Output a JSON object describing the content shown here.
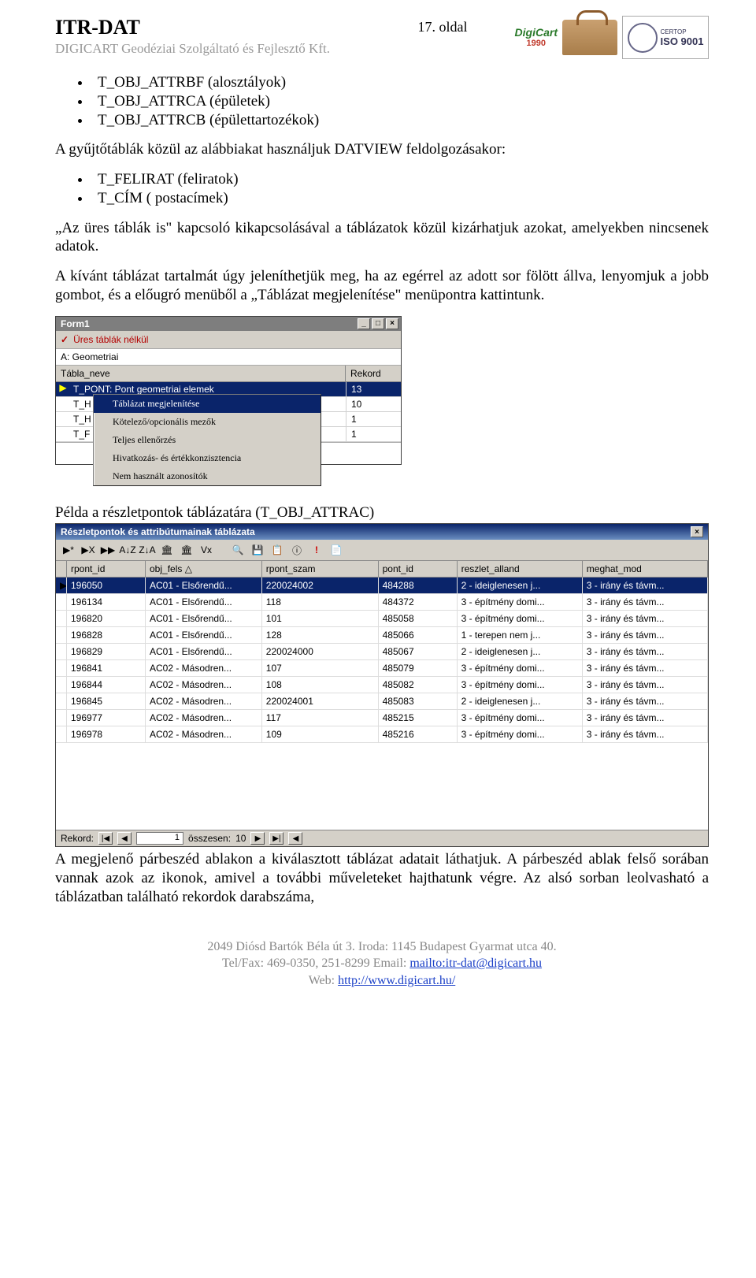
{
  "header": {
    "title": "ITR-DAT",
    "subtitle": "DIGICART Geodéziai Szolgáltató és Fejlesztő Kft.",
    "page_label": "17. oldal",
    "digicart": "DigiCart",
    "digicart_year": "1990",
    "iso": "ISO 9001",
    "certop": "CERTOP"
  },
  "bullets_a": [
    "T_OBJ_ATTRBF (alosztályok)",
    "T_OBJ_ATTRCA (épületek)",
    "T_OBJ_ATTRCB (épülettartozékok)"
  ],
  "para1": "A gyűjtőtáblák közül az alábbiakat használjuk DATVIEW feldolgozásakor:",
  "bullets_b": [
    "T_FELIRAT (feliratok)",
    "T_CÍM ( postacímek)"
  ],
  "para2": "„Az üres táblák is\" kapcsoló kikapcsolásával a táblázatok közül kizárhatjuk azokat, amelyekben nincsenek adatok.",
  "para3": "A kívánt táblázat tartalmát úgy jeleníthetjük meg, ha az egérrel az adott sor fölött állva, lenyomjuk a jobb gombot, és a előugró menüből a „Táblázat megjelenítése\" menüpontra kattintunk.",
  "form1": {
    "title": "Form1",
    "checkbox_label": "Üres táblák nélkül",
    "field_A": "A: Geometriai",
    "col_name": "Tábla_neve",
    "col_rec": "Rekord",
    "rows": [
      {
        "name": "T_PONT: Pont geometriai elemek",
        "rec": "13",
        "sel": true
      },
      {
        "name": "T_H",
        "rec": "10"
      },
      {
        "name": "T_H",
        "rec": "1"
      },
      {
        "name": "T_F",
        "rec": "1"
      }
    ],
    "context_menu": [
      "Táblázat megjelenítése",
      "Kötelező/opcionális mezők",
      "Teljes ellenőrzés",
      "Hivatkozás- és értékkonzisztencia",
      "Nem használt azonosítók"
    ]
  },
  "para_example": "Példa a részletpontok táblázatára (T_OBJ_ATTRAC)",
  "bigwin": {
    "title": "Részletpontok és attribútumainak táblázata",
    "toolbar_icons": [
      "▶*",
      "▶X",
      "▶▶",
      "A↓Z",
      "Z↓A",
      "🏛",
      "🏛",
      "Vx",
      "",
      "🔍",
      "💾",
      "📋",
      "ⓘ",
      "!",
      "📄"
    ],
    "cols": [
      "rpont_id",
      "obj_fels △",
      "rpont_szam",
      "pont_id",
      "reszlet_alland",
      "meghat_mod"
    ],
    "rows": [
      {
        "sel": true,
        "c": [
          "196050",
          "AC01 - Elsőrendű...",
          "220024002",
          "484288",
          "2 - ideiglenesen j...",
          "3 - irány és távm..."
        ]
      },
      {
        "c": [
          "196134",
          "AC01 - Elsőrendű...",
          "118",
          "484372",
          "3 - építmény domi...",
          "3 - irány és távm..."
        ]
      },
      {
        "c": [
          "196820",
          "AC01 - Elsőrendű...",
          "101",
          "485058",
          "3 - építmény domi...",
          "3 - irány és távm..."
        ]
      },
      {
        "c": [
          "196828",
          "AC01 - Elsőrendű...",
          "128",
          "485066",
          "1 - terepen nem j...",
          "3 - irány és távm..."
        ]
      },
      {
        "c": [
          "196829",
          "AC01 - Elsőrendű...",
          "220024000",
          "485067",
          "2 - ideiglenesen j...",
          "3 - irány és távm..."
        ]
      },
      {
        "c": [
          "196841",
          "AC02 - Másodren...",
          "107",
          "485079",
          "3 - építmény domi...",
          "3 - irány és távm..."
        ]
      },
      {
        "c": [
          "196844",
          "AC02 - Másodren...",
          "108",
          "485082",
          "3 - építmény domi...",
          "3 - irány és távm..."
        ]
      },
      {
        "c": [
          "196845",
          "AC02 - Másodren...",
          "220024001",
          "485083",
          "2 - ideiglenesen j...",
          "3 - irány és távm..."
        ]
      },
      {
        "c": [
          "196977",
          "AC02 - Másodren...",
          "117",
          "485215",
          "3 - építmény domi...",
          "3 - irány és távm..."
        ]
      },
      {
        "c": [
          "196978",
          "AC02 - Másodren...",
          "109",
          "485216",
          "3 - építmény domi...",
          "3 - irány és távm..."
        ]
      }
    ],
    "status": {
      "rekord_lbl": "Rekord:",
      "current": "1",
      "total_lbl": "összesen:",
      "total": "10"
    }
  },
  "para4": "A megjelenő párbeszéd ablakon a kiválasztott táblázat adatait láthatjuk. A párbeszéd ablak felső sorában vannak azok az ikonok, amivel a további műveleteket hajthatunk végre. Az alsó sorban leolvasható a táblázatban található rekordok darabszáma,",
  "footer": {
    "line1": "2049 Diósd Bartók Béla út 3. Iroda: 1145 Budapest Gyarmat utca 40.",
    "line2a": "Tel/Fax: 469-0350, 251-8299 Email: ",
    "mail": "mailto:itr-dat@digicart.hu",
    "line3a": "Web: ",
    "web": "http://www.digicart.hu/"
  }
}
